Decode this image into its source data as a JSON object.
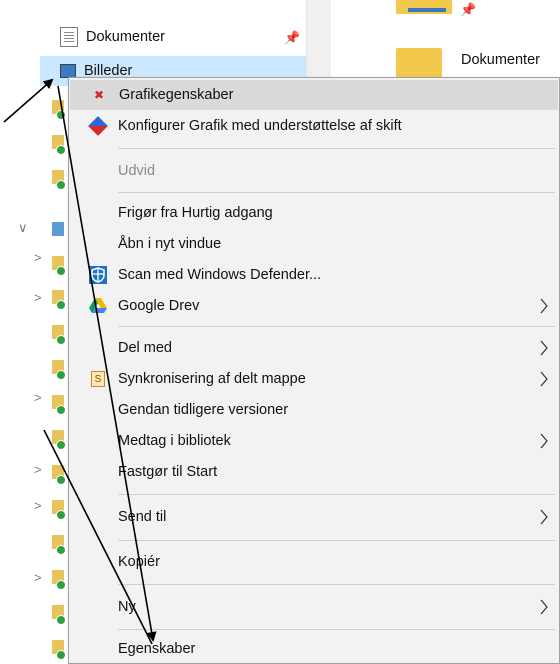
{
  "nav": {
    "documents_label": "Dokumenter",
    "pictures_label": "Billeder"
  },
  "content": {
    "folder_label": "Dokumenter"
  },
  "menu": {
    "items": [
      {
        "label": "Grafikegenskaber",
        "icon": "graphics-properties-icon",
        "highlighted": true
      },
      {
        "label": "Konfigurer Grafik med understøttelse af skift",
        "icon": "switchable-graphics-icon"
      },
      {
        "label": "Udvid",
        "disabled": true
      },
      {
        "label": "Frigør fra Hurtig adgang"
      },
      {
        "label": "Åbn i nyt vindue"
      },
      {
        "label": "Scan med Windows Defender...",
        "icon": "windows-defender-icon"
      },
      {
        "label": "Google Drev",
        "icon": "google-drive-icon",
        "submenu": true
      },
      {
        "label": "Del med",
        "submenu": true
      },
      {
        "label": "Synkronisering af delt mappe",
        "icon": "sync-shared-folder-icon",
        "submenu": true
      },
      {
        "label": "Gendan tidligere versioner"
      },
      {
        "label": "Medtag i bibliotek",
        "submenu": true
      },
      {
        "label": "Fastgør til Start"
      },
      {
        "label": "Send til",
        "submenu": true
      },
      {
        "label": "Kopiér"
      },
      {
        "label": "Ny",
        "submenu": true
      },
      {
        "label": "Egenskaber"
      }
    ]
  },
  "colors": {
    "menu_bg": "#f2f2f2",
    "highlight": "#dadada",
    "selection": "#cce8ff",
    "arrow": "#000000"
  }
}
